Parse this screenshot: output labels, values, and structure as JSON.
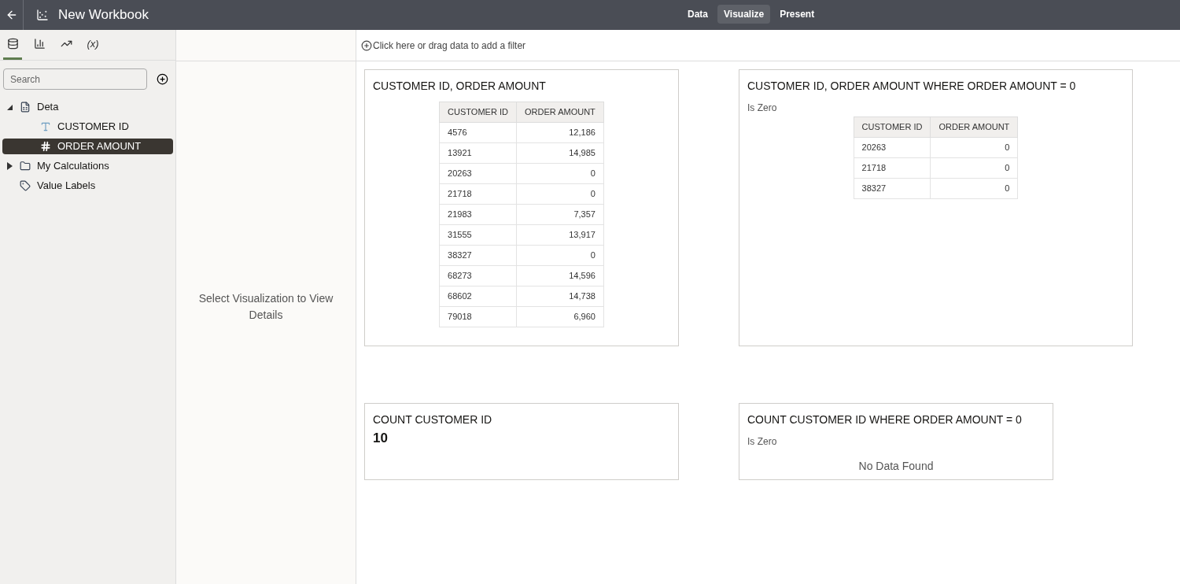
{
  "header": {
    "title": "New Workbook",
    "tabs": [
      {
        "label": "Data",
        "selected": false
      },
      {
        "label": "Visualize",
        "selected": true
      },
      {
        "label": "Present",
        "selected": false
      }
    ]
  },
  "sidebar": {
    "tabs": [
      {
        "kind": "data",
        "selected": true
      },
      {
        "kind": "chart",
        "selected": false
      },
      {
        "kind": "analytics",
        "selected": false
      },
      {
        "kind": "function",
        "label": "(x)",
        "selected": false
      }
    ],
    "search": {
      "placeholder": "Search"
    },
    "tree": [
      {
        "label": "Deta",
        "kind": "dataset",
        "expanded": true,
        "selected": false,
        "children": [
          {
            "label": "CUSTOMER ID",
            "kind": "text",
            "selected": false
          },
          {
            "label": "ORDER AMOUNT",
            "kind": "number",
            "selected": true
          }
        ]
      },
      {
        "label": "My Calculations",
        "kind": "folder",
        "expanded": false,
        "selected": false
      },
      {
        "label": "Value Labels",
        "kind": "tag",
        "selected": false
      }
    ]
  },
  "details": {
    "message": "Select Visualization to View Details"
  },
  "filter_bar": {
    "label": "Click here or drag data to add a filter"
  },
  "rows": [
    [
      {
        "kind": "table",
        "title": "CUSTOMER ID, ORDER AMOUNT",
        "columns": [
          "CUSTOMER ID",
          "ORDER AMOUNT"
        ],
        "rows": [
          [
            "4576",
            "12,186"
          ],
          [
            "13921",
            "14,985"
          ],
          [
            "20263",
            "0"
          ],
          [
            "21718",
            "0"
          ],
          [
            "21983",
            "7,357"
          ],
          [
            "31555",
            "13,917"
          ],
          [
            "38327",
            "0"
          ],
          [
            "68273",
            "14,596"
          ],
          [
            "68602",
            "14,738"
          ],
          [
            "79018",
            "6,960"
          ]
        ]
      },
      {
        "kind": "table",
        "title": "CUSTOMER ID, ORDER AMOUNT WHERE ORDER AMOUNT = 0",
        "subtitle": "Is Zero",
        "columns": [
          "CUSTOMER ID",
          "ORDER AMOUNT"
        ],
        "rows": [
          [
            "20263",
            "0"
          ],
          [
            "21718",
            "0"
          ],
          [
            "38327",
            "0"
          ]
        ]
      }
    ],
    [
      {
        "kind": "metric",
        "title": "COUNT CUSTOMER ID",
        "value": "10"
      },
      {
        "kind": "empty",
        "title": "COUNT CUSTOMER ID WHERE ORDER AMOUNT = 0",
        "subtitle": "Is Zero",
        "message": "No Data Found"
      }
    ]
  ]
}
